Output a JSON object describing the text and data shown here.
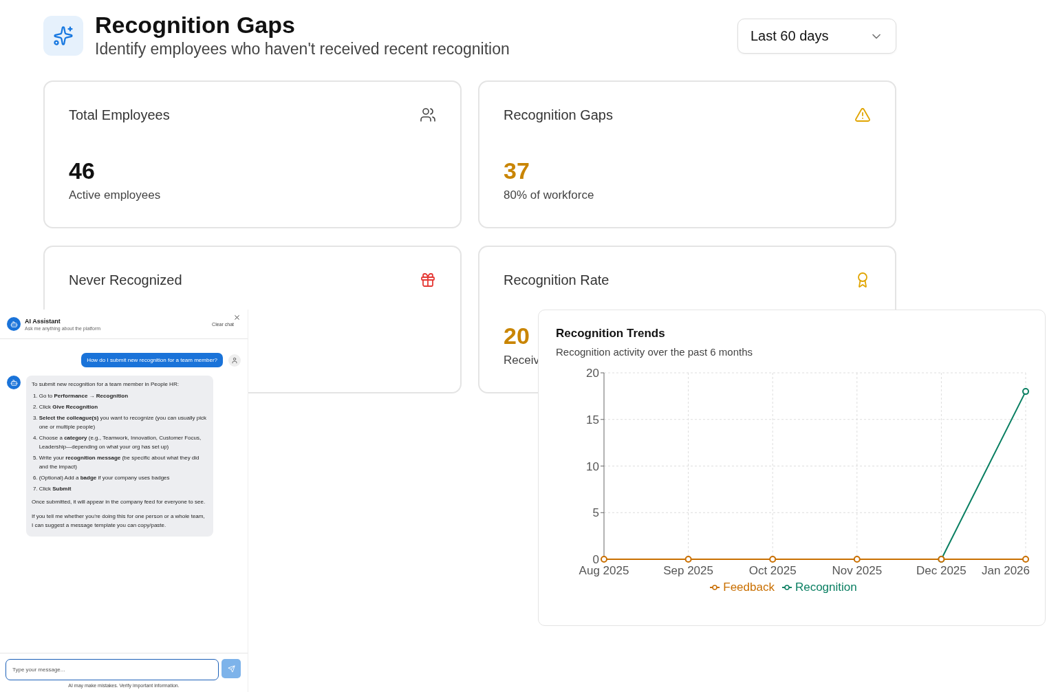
{
  "header": {
    "title": "Recognition Gaps",
    "subtitle": "Identify employees who haven't received recent recognition",
    "period": {
      "value": "Last 60 days"
    }
  },
  "stats": [
    {
      "title": "Total Employees",
      "kind": "users",
      "value": "46",
      "caption": "Active employees",
      "color": "#111111"
    },
    {
      "title": "Recognition Gaps",
      "kind": "alert",
      "value": "37",
      "caption": "80% of workforce",
      "color": "#c98500"
    },
    {
      "title": "Never Recognized",
      "kind": "gift"
    },
    {
      "title": "Recognition Rate",
      "kind": "award",
      "value": "20",
      "caption": "Receiv",
      "color": "#c98500"
    }
  ],
  "chat": {
    "title": "AI Assistant",
    "subtitle": "Ask me anything about the platform",
    "clear_label": "Clear chat",
    "messages": [
      {
        "kind": "user",
        "text": "How do I submit new recognition for a team member?"
      },
      {
        "kind": "assistant",
        "intro": "To submit new recognition for a team member in People HR:",
        "steps": [
          {
            "number": "1.",
            "text": "Go to **Performance → Recognition**"
          },
          {
            "number": "2.",
            "text": "Click **Give Recognition**"
          },
          {
            "number": "3.",
            "text": "**Select the colleague(s)** you want to recognize (you can usually pick one or multiple people)"
          },
          {
            "number": "4.",
            "text": "Choose a **category** (e.g., Teamwork, Innovation, Customer Focus, Leadership—depending on what your org has set up)"
          },
          {
            "number": "5.",
            "text": "Write your **recognition message** (be specific about what they did and the impact)"
          },
          {
            "number": "6.",
            "text": "(Optional) Add a **badge** if your company uses badges"
          },
          {
            "number": "7.",
            "text": "Click **Submit**"
          }
        ],
        "outro": [
          "Once submitted, it will appear in the company feed for everyone to see.",
          "If you tell me whether you’re doing this for one person or a whole team, I can suggest a message template you can copy/paste."
        ]
      }
    ],
    "input": {
      "placeholder": "Type your message..."
    },
    "disclaimer": "AI may make mistakes. Verify important information."
  },
  "trends": {
    "title": "Recognition Trends",
    "subtitle": "Recognition activity over the past 6 months",
    "chart_data": {
      "type": "line",
      "categories": [
        "Aug 2025",
        "Sep 2025",
        "Oct 2025",
        "Nov 2025",
        "Dec 2025",
        "Jan 2026"
      ],
      "series": [
        {
          "name": "Feedback",
          "color": "#c96f00",
          "marker": "circle",
          "values": [
            0,
            0,
            0,
            0,
            0,
            0
          ]
        },
        {
          "name": "Recognition",
          "color": "#0a7f62",
          "marker": "circle",
          "values": [
            null,
            null,
            null,
            null,
            0,
            18
          ]
        }
      ],
      "grid": true,
      "ylim": [
        0,
        20
      ],
      "yticks": [
        0,
        5,
        10,
        15,
        20
      ]
    }
  }
}
